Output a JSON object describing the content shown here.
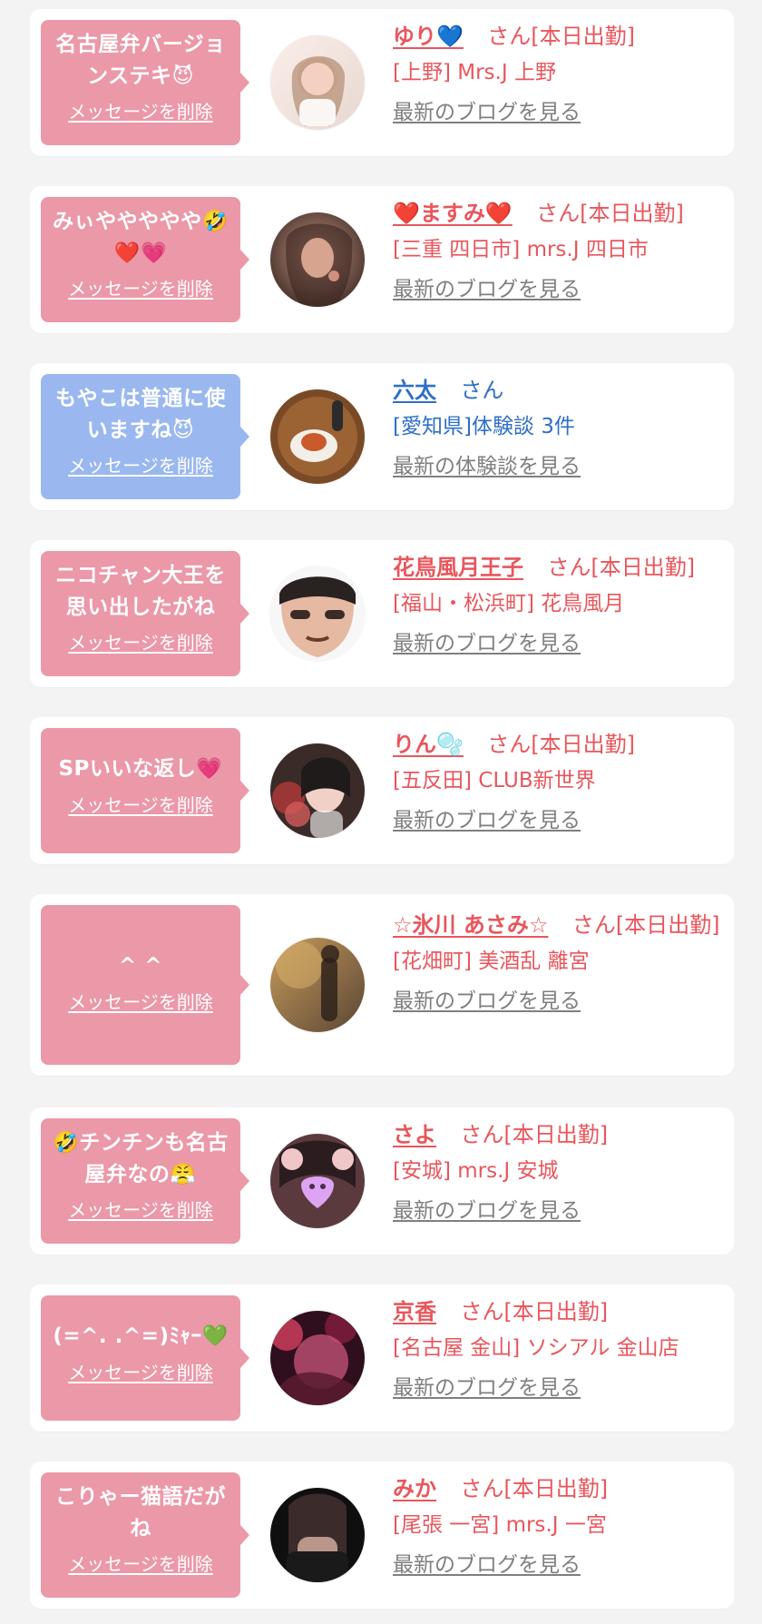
{
  "cards": [
    {
      "bubble_color": "#eb98a8",
      "message": "名古屋弁バージョ\nンステキ😈",
      "delete_label": "メッセージを削除",
      "name": "ゆり💙",
      "san": "さん[本日出勤]",
      "location": "[上野] Mrs.J 上野",
      "link": "最新のブログを見る",
      "accent": "#e8565c",
      "avatar": "avatar-woman-light"
    },
    {
      "bubble_color": "#eb98a8",
      "message": "みぃややややや🤣\n❤️💗",
      "delete_label": "メッセージを削除",
      "name": "❤️ますみ❤️",
      "san": "さん[本日出勤]",
      "location": "[三重 四日市] mrs.J 四日市",
      "link": "最新のブログを見る",
      "accent": "#e8565c",
      "avatar": "avatar-woman-dark"
    },
    {
      "bubble_color": "#9ab8ef",
      "message": "もやこは普通に使\nいますね😈",
      "delete_label": "メッセージを削除",
      "name": "六太",
      "san": "さん",
      "location": "[愛知県]体験談 3件",
      "link": "最新の体験談を見る",
      "accent": "#2e6fc7",
      "avatar": "avatar-food"
    },
    {
      "bubble_color": "#eb98a8",
      "message": "ニコチャン大王を\n思い出したがね",
      "delete_label": "メッセージを削除",
      "name": "花鳥風月王子",
      "san": "さん[本日出勤]",
      "location": "[福山・松浜町] 花鳥風月",
      "link": "最新のブログを見る",
      "accent": "#e8565c",
      "avatar": "avatar-man-face"
    },
    {
      "bubble_color": "#eb98a8",
      "message": "SPいいな返し💗",
      "delete_label": "メッセージを削除",
      "name": "りん🫧",
      "san": "さん[本日出勤]",
      "location": "[五反田] CLUB新世界",
      "link": "最新のブログを見る",
      "accent": "#e8565c",
      "avatar": "avatar-woman-flowers"
    },
    {
      "bubble_color": "#eb98a8",
      "message": "^ ^",
      "delete_label": "メッセージを削除",
      "name": "☆氷川 あさみ☆",
      "san": "さん[本日出勤]",
      "location": "[花畑町] 美酒乱 離宮",
      "link": "最新のブログを見る",
      "accent": "#e8565c",
      "avatar": "avatar-autumn"
    },
    {
      "bubble_color": "#eb98a8",
      "message": "🤣チンチンも名古\n屋弁なの😤",
      "delete_label": "メッセージを削除",
      "name": "さよ",
      "san": "さん[本日出勤]",
      "location": "[安城] mrs.J 安城",
      "link": "最新のブログを見る",
      "accent": "#e8565c",
      "avatar": "avatar-bunny"
    },
    {
      "bubble_color": "#eb98a8",
      "message": "(=^. .^=)ﾐｬｰ💚",
      "delete_label": "メッセージを削除",
      "name": "京香",
      "san": "さん[本日出勤]",
      "location": "[名古屋 金山] ソシアル 金山店",
      "link": "最新のブログを見る",
      "accent": "#e8565c",
      "avatar": "avatar-kimono"
    },
    {
      "bubble_color": "#eb98a8",
      "message": "こりゃー猫語だが\nね",
      "delete_label": "メッセージを削除",
      "name": "みか",
      "san": "さん[本日出勤]",
      "location": "[尾張 一宮] mrs.J 一宮",
      "link": "最新のブログを見る",
      "accent": "#e8565c",
      "avatar": "avatar-legs"
    }
  ]
}
